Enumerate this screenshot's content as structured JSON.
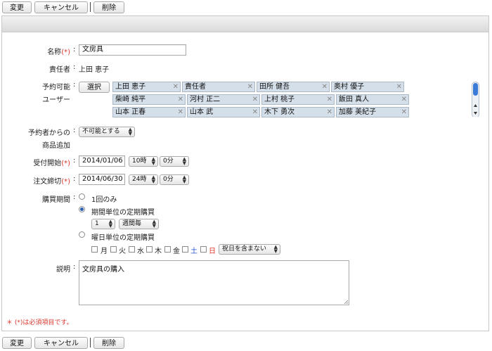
{
  "toolbar": {
    "change_label": "変更",
    "cancel_label": "キャンセル",
    "delete_label": "削除"
  },
  "form": {
    "name": {
      "label": "名称",
      "required_mark": "(*)",
      "colon": ":",
      "value": "文房具"
    },
    "owner": {
      "label": "責任者",
      "colon": ":",
      "value": "上田 恵子"
    },
    "users": {
      "label_line1": "予約可能",
      "label_line2": "ユーザー",
      "colon": ":",
      "select_button": "選択",
      "chips": [
        "上田 恵子",
        "責任者",
        "田所 健吾",
        "奥村 優子",
        "柴崎 純平",
        "河村 正二",
        "上村 桃子",
        "飯田 真人",
        "山本 正春",
        "山本 武",
        "木下 勇次",
        "加藤 美紀子"
      ],
      "remove_glyph": "✕"
    },
    "add_goods": {
      "label_line1": "予約者からの",
      "label_line2": "商品追加",
      "colon": ":",
      "value": "不可能とする"
    },
    "start": {
      "label": "受付開始",
      "required_mark": "(*)",
      "colon": ":",
      "date": "2014/01/06",
      "hour": "10時",
      "minute": "0分"
    },
    "deadline": {
      "label": "注文締切",
      "required_mark": "(*)",
      "colon": ":",
      "date": "2014/06/30",
      "hour": "24時",
      "minute": "0分"
    },
    "period": {
      "label": "購買期間",
      "colon": ":",
      "option_once": "1回のみ",
      "option_interval": "期間単位の定期購買",
      "interval_count": "1",
      "interval_unit": "週間毎",
      "option_weekday": "曜日単位の定期購買",
      "weekdays": [
        "月",
        "火",
        "水",
        "木",
        "金",
        "土",
        "日"
      ],
      "holiday": "祝日を含まない",
      "selected": "interval"
    },
    "description": {
      "label": "説明",
      "colon": ":",
      "value": "文房具の購入"
    },
    "required_note": "＊ (*)は必須項目です。"
  },
  "colors": {
    "required": "#d9362b",
    "saturday": "#2a55c9",
    "sunday": "#d9362b",
    "chip_bg": "#d4dfe9",
    "radio_accent": "#2b5fb3"
  }
}
